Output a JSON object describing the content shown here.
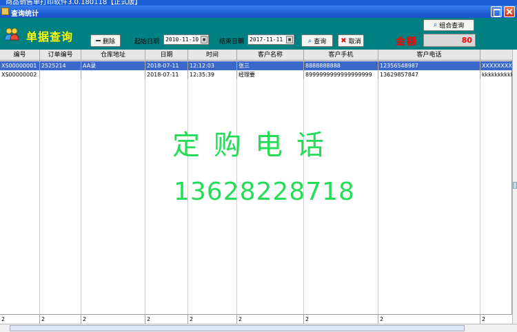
{
  "window": {
    "outer_title": "商品销售单打印软件3.0.180118【正式版】",
    "inner_title": "查询统计"
  },
  "toolbar": {
    "page_title": "单据查询",
    "delete_label": "删除",
    "start_date_label": "起始日期",
    "start_date_value": "2010-11-10",
    "end_date_label": "结束日期",
    "end_date_value": "2017-11-11",
    "query_label": "查询",
    "cancel_label": "取消",
    "combo_query_label": "组合查询",
    "amount_label": "金额",
    "amount_value": "80"
  },
  "table": {
    "columns": [
      "编号",
      "订单编号",
      "仓库地址",
      "日期",
      "时间",
      "客户名称",
      "客户手机",
      "客户电话",
      ""
    ],
    "rows": [
      [
        "XS00000001",
        "2525214",
        "AA录",
        "2018-07-11",
        "12:12:03",
        "张三",
        "8888888888",
        "12356548987",
        "XXXXXXXXX"
      ],
      [
        "XS00000002",
        "",
        "",
        "2018-07-11",
        "12:35:39",
        "经理要",
        "8999999999999999999",
        "13629857847",
        "kkkkkkkkkk"
      ]
    ],
    "footer": [
      "2",
      "2",
      "2",
      "2",
      "2",
      "2",
      "2",
      "2",
      "2"
    ]
  },
  "watermark": {
    "line1": "定购电话",
    "line2": "13628228718"
  },
  "colors": {
    "toolbar_bg": "#008080",
    "title_bar": "#1c5ed6",
    "selection": "#3b68c8",
    "watermark": "#22dd55",
    "amount": "#ff0000"
  }
}
